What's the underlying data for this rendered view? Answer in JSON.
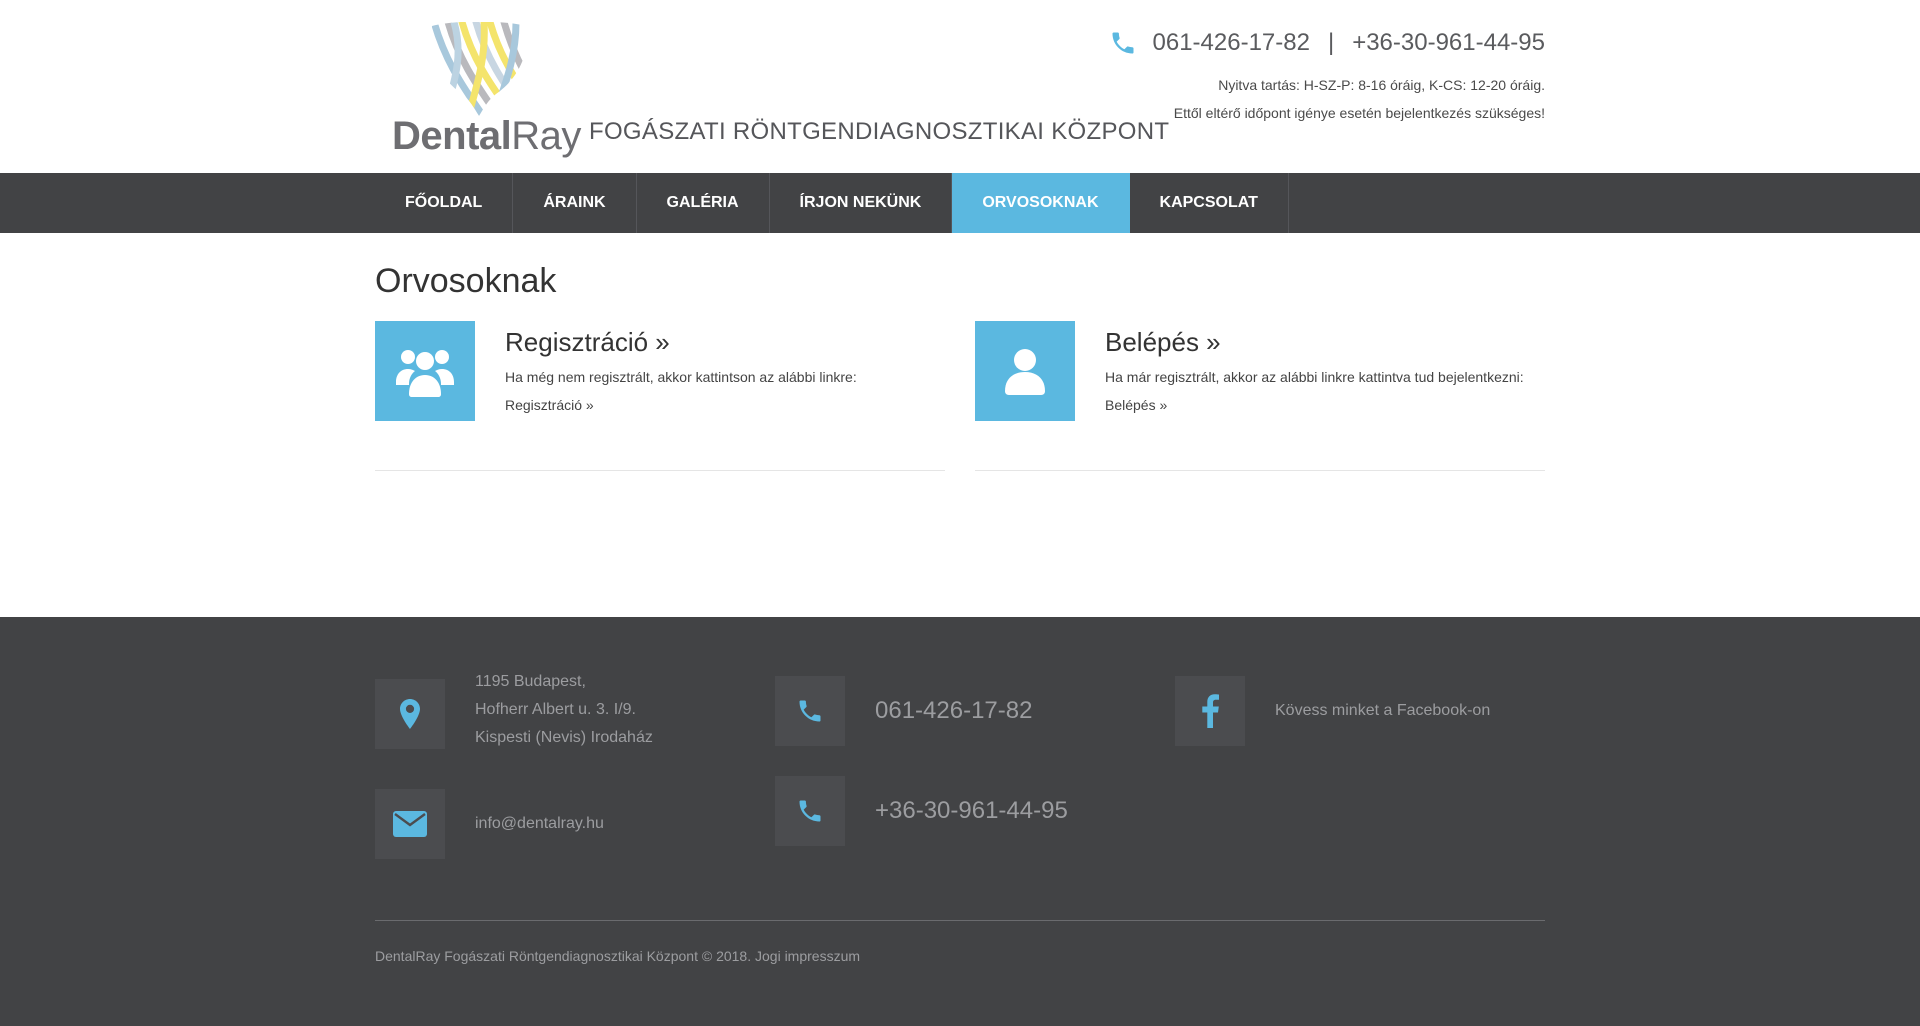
{
  "header": {
    "logo_primary": "Dental",
    "logo_secondary": "Ray",
    "tagline": "FOGÁSZATI RÖNTGENDIAGNOSZTIKAI KÖZPONT",
    "phone_1": "061-426-17-82",
    "phone_separator": "|",
    "phone_2": "+36-30-961-44-95",
    "hours": "Nyitva tartás: H-SZ-P: 8-16 óráig, K-CS: 12-20 óráig.",
    "appointment_note": "Ettől eltérő időpont igénye esetén bejelentkezés szükséges!",
    "icons": {
      "phone": "phone-icon"
    }
  },
  "nav": {
    "items": [
      {
        "label": "FŐOLDAL",
        "active": false
      },
      {
        "label": "ÁRAINK",
        "active": false
      },
      {
        "label": "GALÉRIA",
        "active": false
      },
      {
        "label": "ÍRJON NEKÜNK",
        "active": false
      },
      {
        "label": "ORVOSOKNAK",
        "active": true
      },
      {
        "label": "KAPCSOLAT",
        "active": false
      }
    ]
  },
  "main": {
    "title": "Orvosoknak",
    "register": {
      "title": "Regisztráció »",
      "description": "Ha még nem regisztrált, akkor kattintson az alábbi linkre:",
      "link": "Regisztráció »",
      "icon": "users-icon"
    },
    "login": {
      "title": "Belépés »",
      "description": "Ha már regisztrált, akkor az alábbi linkre kattintva tud bejelentkezni:",
      "link": "Belépés »",
      "icon": "user-icon"
    }
  },
  "footer": {
    "address": {
      "line_1": "1195 Budapest,",
      "line_2": "Hofherr Albert u. 3. I/9.",
      "line_3": "Kispesti (Nevis) Irodaház",
      "icon": "map-pin-icon"
    },
    "email": {
      "value": "info@dentalray.hu",
      "icon": "envelope-icon"
    },
    "phone_1": {
      "value": "061-426-17-82",
      "icon": "phone-icon"
    },
    "phone_2": {
      "value": "+36-30-961-44-95",
      "icon": "phone-icon"
    },
    "facebook": {
      "label": "Kövess minket a Facebook-on",
      "icon": "facebook-icon"
    },
    "copyright": "DentalRay Fogászati Röntgendiagnosztikai Központ © 2018.",
    "legal_link": "Jogi impresszum"
  },
  "colors": {
    "accent": "#5bb8e0",
    "nav_bg": "#424345",
    "footer_bg": "#424345",
    "footer_text": "#9c9da0"
  }
}
